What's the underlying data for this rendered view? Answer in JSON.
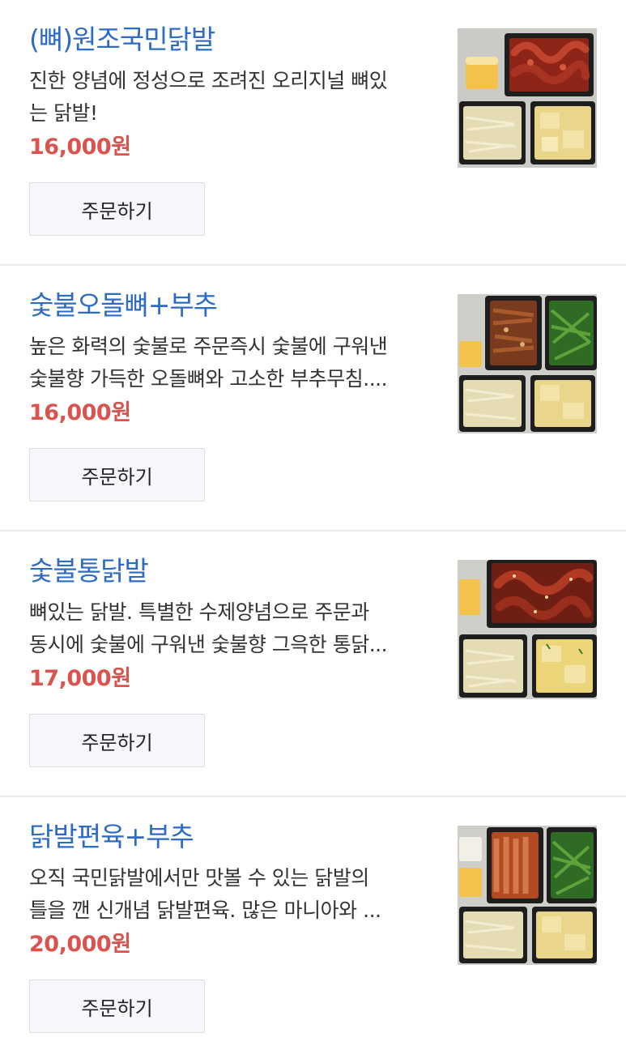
{
  "menu": {
    "items": [
      {
        "name": "(뼈)원조국민닭발",
        "desc_line1": "진한 양념에 정성으로 조려진 오리지널 뼈있",
        "desc_line2": "는 닭발!",
        "price": "16,000원",
        "order_label": "주문하기",
        "image": "bone-in-chicken-feet-set-photo"
      },
      {
        "name": "숯불오돌뼈+부추",
        "desc_line1": "높은 화력의 숯불로 주문즉시 숯불에 구워낸",
        "desc_line2": "숯불향 가득한 오돌뼈와 고소한 부추무침....",
        "price": "16,000원",
        "order_label": "주문하기",
        "image": "charcoal-cartilage-chives-set-photo"
      },
      {
        "name": "숯불통닭발",
        "desc_line1": "뼈있는 닭발. 특별한 수제양념으로 주문과",
        "desc_line2": "동시에 숯불에 구워낸 숯불향 그윽한 통닭...",
        "price": "17,000원",
        "order_label": "주문하기",
        "image": "charcoal-whole-chicken-feet-set-photo"
      },
      {
        "name": "닭발편육+부추",
        "desc_line1": "오직 국민닭발에서만 맛볼 수 있는 닭발의",
        "desc_line2": "틀을 깬 신개념 닭발편육. 많은 마니아와 ...",
        "price": "20,000원",
        "order_label": "주문하기",
        "image": "chicken-feet-slices-chives-set-photo"
      }
    ]
  },
  "colors": {
    "name": "#2d6bc4",
    "price": "#d9534f",
    "divider": "#e9ebee",
    "button_bg": "#f5f7fa"
  }
}
